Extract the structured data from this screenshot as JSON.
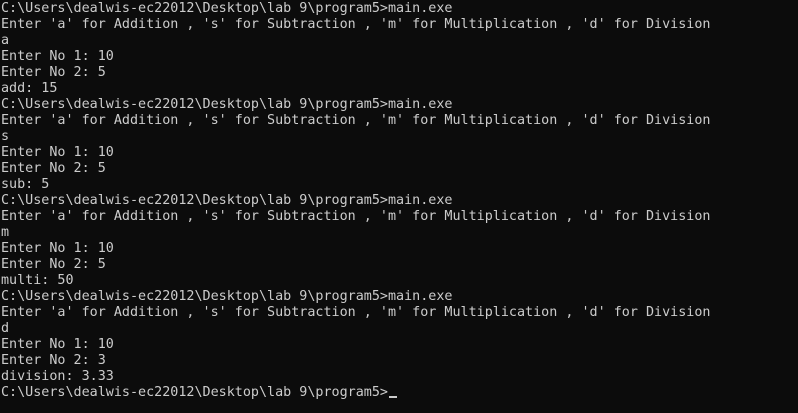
{
  "console": {
    "lines": [
      "C:\\Users\\dealwis-ec22012\\Desktop\\lab 9\\program5>main.exe",
      "Enter 'a' for Addition , 's' for Subtraction , 'm' for Multiplication , 'd' for Division",
      "a",
      "Enter No 1: 10",
      "Enter No 2: 5",
      "add: 15",
      "C:\\Users\\dealwis-ec22012\\Desktop\\lab 9\\program5>main.exe",
      "Enter 'a' for Addition , 's' for Subtraction , 'm' for Multiplication , 'd' for Division",
      "s",
      "Enter No 1: 10",
      "Enter No 2: 5",
      "sub: 5",
      "C:\\Users\\dealwis-ec22012\\Desktop\\lab 9\\program5>main.exe",
      "Enter 'a' for Addition , 's' for Subtraction , 'm' for Multiplication , 'd' for Division",
      "m",
      "Enter No 1: 10",
      "Enter No 2: 5",
      "multi: 50",
      "C:\\Users\\dealwis-ec22012\\Desktop\\lab 9\\program5>main.exe",
      "Enter 'a' for Addition , 's' for Subtraction , 'm' for Multiplication , 'd' for Division",
      "d",
      "Enter No 1: 10",
      "Enter No 2: 3",
      "division: 3.33"
    ],
    "prompt": "C:\\Users\\dealwis-ec22012\\Desktop\\lab 9\\program5>",
    "colors": {
      "background": "#0c0c0c",
      "text": "#cccccc"
    }
  }
}
